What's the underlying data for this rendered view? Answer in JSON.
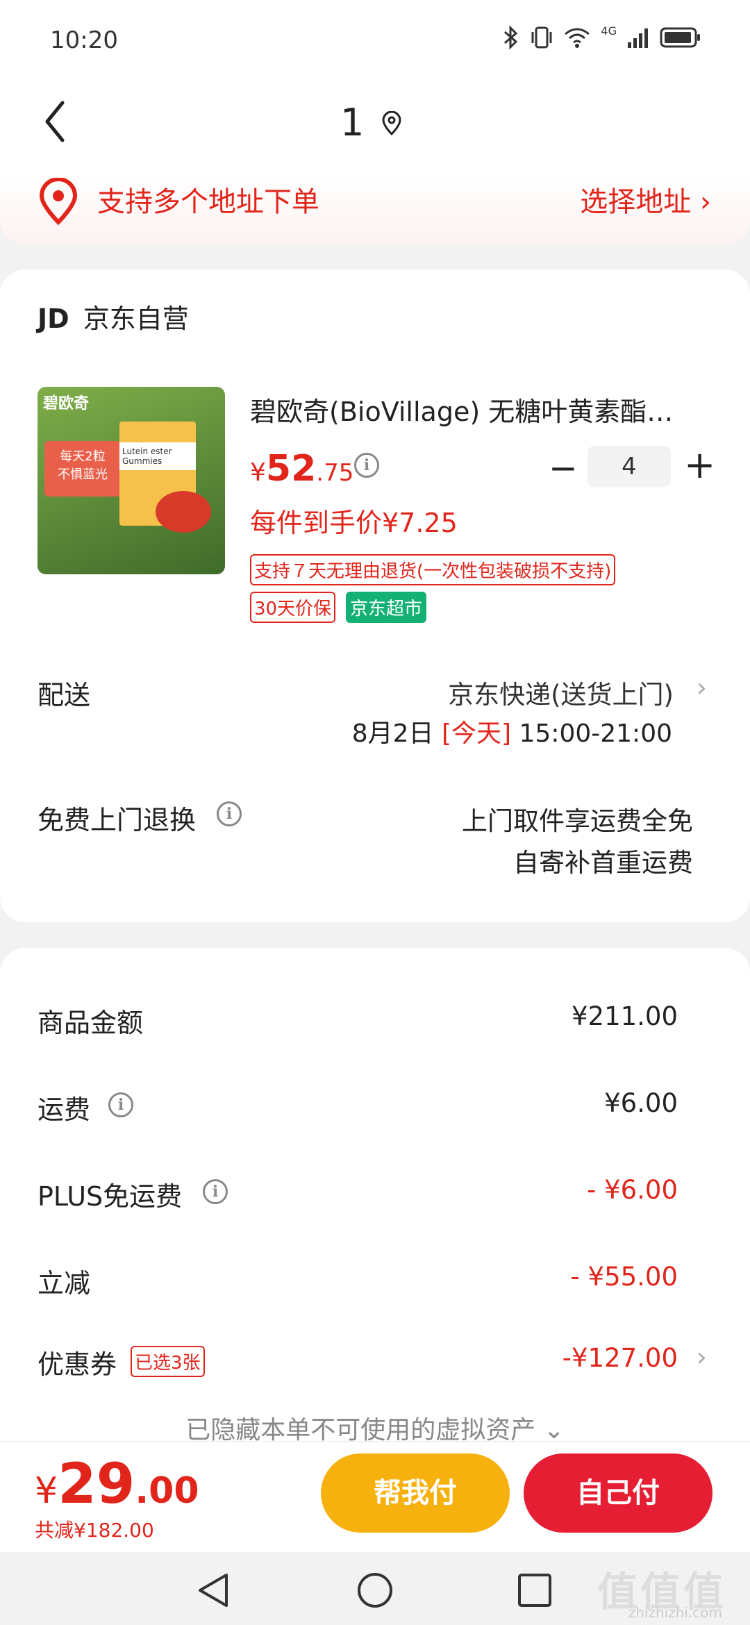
{
  "status_bar": {
    "time": "10:20",
    "network": "4G"
  },
  "header": {
    "title": "1"
  },
  "address_banner": {
    "text": "支持多个地址下单",
    "link": "选择地址 ›"
  },
  "shop": {
    "logo": "JD",
    "name": "京东自营"
  },
  "product": {
    "name": "碧欧奇(BioVillage) 无糖叶黄素酯软…",
    "price_currency": "¥",
    "price_int": "52",
    "price_dec": ".75",
    "quantity": "4",
    "net_price": "每件到手价¥7.25",
    "tags": {
      "return": "支持７天无理由退货(一次性包装破损不支持)",
      "price_protect": "30天价保",
      "market": "京东超市"
    },
    "image_text": {
      "brand": "碧欧奇",
      "line1": "每天2粒",
      "line2": "不惧蓝光",
      "box": "Lutein ester Gummies"
    }
  },
  "delivery": {
    "label": "配送",
    "method": "京东快递(送货上门)",
    "date": "8月2日",
    "today": "[今天]",
    "time": "15:00-21:00"
  },
  "free_return": {
    "label": "免费上门退换",
    "value1": "上门取件享运费全免",
    "value2": "自寄补首重运费"
  },
  "summary": {
    "goods_label": "商品金额",
    "goods_value": "¥211.00",
    "shipping_label": "运费",
    "shipping_value": "¥6.00",
    "plus_label": "PLUS免运费",
    "plus_value": "- ¥6.00",
    "discount_label": "立减",
    "discount_value": "- ¥55.00",
    "coupon_label": "优惠券",
    "coupon_badge": "已选3张",
    "coupon_value": "-¥127.00",
    "hidden_assets": "已隐藏本单不可使用的虚拟资产 ⌄"
  },
  "bottom_bar": {
    "currency": "¥",
    "total_int": "29",
    "total_dec": ".00",
    "saved": "共减¥182.00",
    "help_pay": "帮我付",
    "self_pay": "自己付"
  },
  "watermark": {
    "main": "值值值",
    "sub": "zhizhizhi.com"
  },
  "colors": {
    "accent": "#e1251b",
    "help_button": "#f7b10f",
    "self_button": "#e61e33",
    "market_tag": "#13b173"
  }
}
